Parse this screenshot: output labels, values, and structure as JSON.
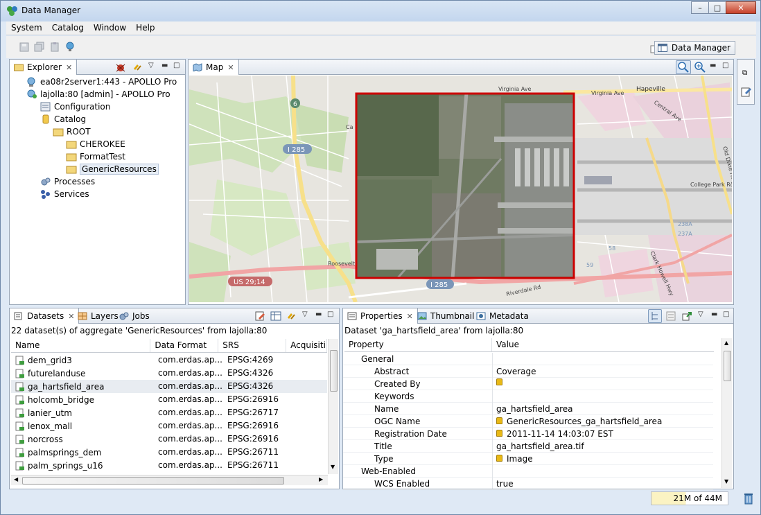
{
  "window": {
    "title": "Data Manager"
  },
  "menu": [
    "System",
    "Catalog",
    "Window",
    "Help"
  ],
  "perspective": {
    "label": "Data Manager"
  },
  "explorer": {
    "tab": "Explorer",
    "items": [
      {
        "label": "ea08r2server1:443 - APOLLO Pro",
        "icon": "server-icon"
      },
      {
        "label": "lajolla:80 [admin] - APOLLO Pro",
        "icon": "server-connected-icon"
      },
      {
        "label": "Configuration",
        "icon": "config-icon"
      },
      {
        "label": "Catalog",
        "icon": "database-icon"
      },
      {
        "label": "ROOT",
        "icon": "folder-icon"
      },
      {
        "label": "CHEROKEE",
        "icon": "folder-icon"
      },
      {
        "label": "FormatTest",
        "icon": "folder-icon"
      },
      {
        "label": "GenericResources",
        "icon": "folder-icon"
      },
      {
        "label": "Processes",
        "icon": "processes-icon"
      },
      {
        "label": "Services",
        "icon": "services-icon"
      }
    ]
  },
  "map": {
    "tab": "Map",
    "labels": {
      "virginia_ave_1": "Virginia Ave",
      "virginia_ave_2": "Virginia Ave",
      "hapeville": "Hapeville",
      "central_ave": "Central Ave",
      "route_6": "6",
      "i285_top": "I 285",
      "i285_bottom": "I 285",
      "us29": "US 29;14",
      "roosevelt": "Roosevelt",
      "riverdale": "Riverdale Rd",
      "college_park": "College Park Rd",
      "old_dixie": "Old Dixie Hwy",
      "clark_howell": "Clark Howell Hwy",
      "r58": "58",
      "r59": "59",
      "r238a": "238A",
      "r237a": "237A",
      "ca": "Ca"
    }
  },
  "datasets": {
    "tabs": [
      "Datasets",
      "Layers",
      "Jobs"
    ],
    "summary": "22 dataset(s) of aggregate 'GenericResources' from lajolla:80",
    "columns": [
      "Name",
      "Data Format",
      "SRS",
      "Acquisiti"
    ],
    "rows": [
      {
        "name": "dem_grid3",
        "format": "com.erdas.ap...",
        "srs": "EPSG:4269"
      },
      {
        "name": "futurelanduse",
        "format": "com.erdas.ap...",
        "srs": "EPSG:4326"
      },
      {
        "name": "ga_hartsfield_area",
        "format": "com.erdas.ap...",
        "srs": "EPSG:4326"
      },
      {
        "name": "holcomb_bridge",
        "format": "com.erdas.ap...",
        "srs": "EPSG:26916"
      },
      {
        "name": "lanier_utm",
        "format": "com.erdas.ap...",
        "srs": "EPSG:26717"
      },
      {
        "name": "lenox_mall",
        "format": "com.erdas.ap...",
        "srs": "EPSG:26916"
      },
      {
        "name": "norcross",
        "format": "com.erdas.ap...",
        "srs": "EPSG:26916"
      },
      {
        "name": "palmsprings_dem",
        "format": "com.erdas.ap...",
        "srs": "EPSG:26711"
      },
      {
        "name": "palm_springs_u16",
        "format": "com.erdas.ap...",
        "srs": "EPSG:26711"
      }
    ]
  },
  "properties": {
    "tabs": [
      "Properties",
      "Thumbnail",
      "Metadata"
    ],
    "summary": "Dataset 'ga_hartsfield_area' from lajolla:80",
    "columns": [
      "Property",
      "Value"
    ],
    "rows": [
      {
        "key": "General",
        "value": "",
        "level": 1,
        "lock": false
      },
      {
        "key": "Abstract",
        "value": "Coverage",
        "level": 2,
        "lock": false
      },
      {
        "key": "Created By",
        "value": "",
        "level": 2,
        "lock": true
      },
      {
        "key": "Keywords",
        "value": "",
        "level": 2,
        "lock": false
      },
      {
        "key": "Name",
        "value": "ga_hartsfield_area",
        "level": 2,
        "lock": false
      },
      {
        "key": "OGC Name",
        "value": "GenericResources_ga_hartsfield_area",
        "level": 2,
        "lock": true
      },
      {
        "key": "Registration Date",
        "value": "2011-11-14 14:03:07 EST",
        "level": 2,
        "lock": true
      },
      {
        "key": "Title",
        "value": "ga_hartsfield_area.tif",
        "level": 2,
        "lock": false
      },
      {
        "key": "Type",
        "value": "Image",
        "level": 2,
        "lock": true
      },
      {
        "key": "Web-Enabled",
        "value": "",
        "level": 1,
        "lock": false
      },
      {
        "key": "WCS Enabled",
        "value": "true",
        "level": 2,
        "lock": false
      }
    ]
  },
  "status": {
    "memory": "21M of 44M",
    "memory_used_fraction": 0.48
  }
}
